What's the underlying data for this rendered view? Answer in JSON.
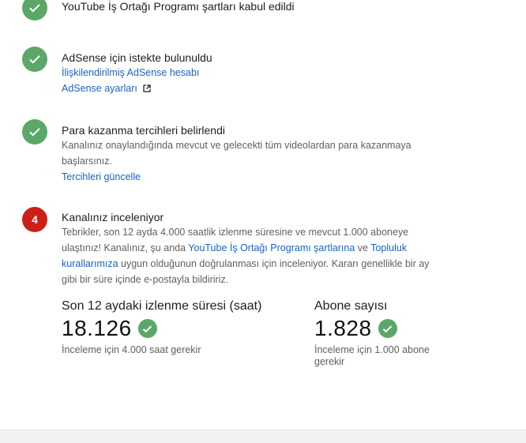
{
  "steps": [
    {
      "title": "YouTube İş Ortağı Programı şartları kabul edildi"
    },
    {
      "title": "AdSense için istekte bulunuldu",
      "link1": "İlişkilendirilmiş AdSense hesabı",
      "link2": "AdSense ayarları"
    },
    {
      "title": "Para kazanma tercihleri belirlendi",
      "desc_line1": "Kanalınız onaylandığında mevcut ve gelecekti tüm videolardan para kazanmaya",
      "desc_line2": "başlarsınız.",
      "link": "Tercihleri güncelle"
    },
    {
      "number": "4",
      "title": "Kanalınız inceleniyor",
      "desc_part1": "Tebrikler, son 12 ayda 4.000 saatlik izlenme süresine ve mevcut 1.000 aboneye ulaştınız! Kanalınız, şu anda ",
      "desc_link1": "YouTube İş Ortağı Programı şartlarına",
      "desc_part2": " ve ",
      "desc_link2": "Topluluk kurallarımıza",
      "desc_part3": " uygun olduğunun doğrulanması için inceleniyor. Kararı genellikle bir ay gibi bir süre içinde e-postayla bildiririz."
    }
  ],
  "stats": {
    "watch": {
      "label": "Son 12 aydaki izlenme süresi (saat)",
      "value": "18.126",
      "note": "İnceleme için 4.000 saat gerekir"
    },
    "subs": {
      "label": "Abone sayısı",
      "value": "1.828",
      "note": "İnceleme için 1.000 abone gerekir"
    }
  },
  "icons": {
    "done": "check-circle-icon",
    "external": "external-link-icon"
  },
  "colors": {
    "success": "#5ba767",
    "pending": "#cc1f18",
    "link": "#1a63c2"
  }
}
